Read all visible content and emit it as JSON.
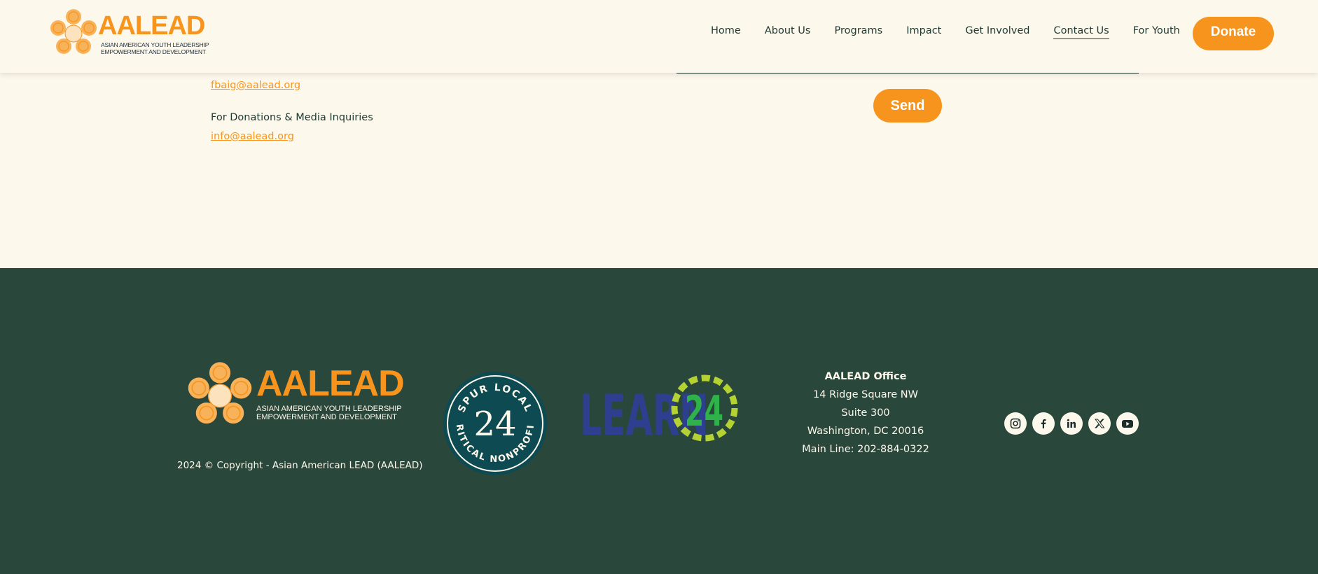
{
  "header": {
    "logo_text": "AALEAD",
    "logo_subtitle_line1": "ASIAN AMERICAN YOUTH LEADERSHIP",
    "logo_subtitle_line2": "EMPOWERMENT AND DEVELOPMENT",
    "nav": [
      {
        "label": "Home",
        "active": false
      },
      {
        "label": "About Us",
        "active": false
      },
      {
        "label": "Programs",
        "active": false
      },
      {
        "label": "Impact",
        "active": false
      },
      {
        "label": "Get Involved",
        "active": false
      },
      {
        "label": "Contact Us",
        "active": true
      },
      {
        "label": "For Youth",
        "active": false
      }
    ],
    "donate_label": "Donate"
  },
  "contact": {
    "email_1": "fbaig@aalead.org",
    "donations_label": "For Donations & Media Inquiries",
    "email_2": "info@aalead.org",
    "send_label": "Send"
  },
  "footer": {
    "logo_text": "AALEAD",
    "logo_subtitle_line1": "ASIAN AMERICAN YOUTH LEADERSHIP",
    "logo_subtitle_line2": "EMPOWERMENT AND DEVELOPMENT",
    "copyright": "2024 © Copyright - Asian American LEAD (AALEAD)",
    "badge_top": "SPUR LOCAL",
    "badge_number": "24",
    "badge_bottom": "CRITICAL NONPROFIT",
    "learn_text": "LEARN",
    "learn_number": "24",
    "office": {
      "title": "AALEAD Office",
      "address_1": "14 Ridge Square NW",
      "address_2": "Suite 300",
      "address_3": "Washington, DC 20016",
      "phone": "Main Line: 202-884-0322"
    },
    "socials": [
      "instagram-icon",
      "facebook-icon",
      "linkedin-icon",
      "x-icon",
      "youtube-icon"
    ]
  },
  "colors": {
    "accent": "#f7941d",
    "page_bg": "#fdf8ec",
    "footer_bg": "#2a473c",
    "text_dark": "#1f3a33",
    "badge_bg": "#0e4a52",
    "learn_blue": "#2f3f8f",
    "learn_green": "#2fb24a",
    "learn_lime": "#b5d233"
  }
}
